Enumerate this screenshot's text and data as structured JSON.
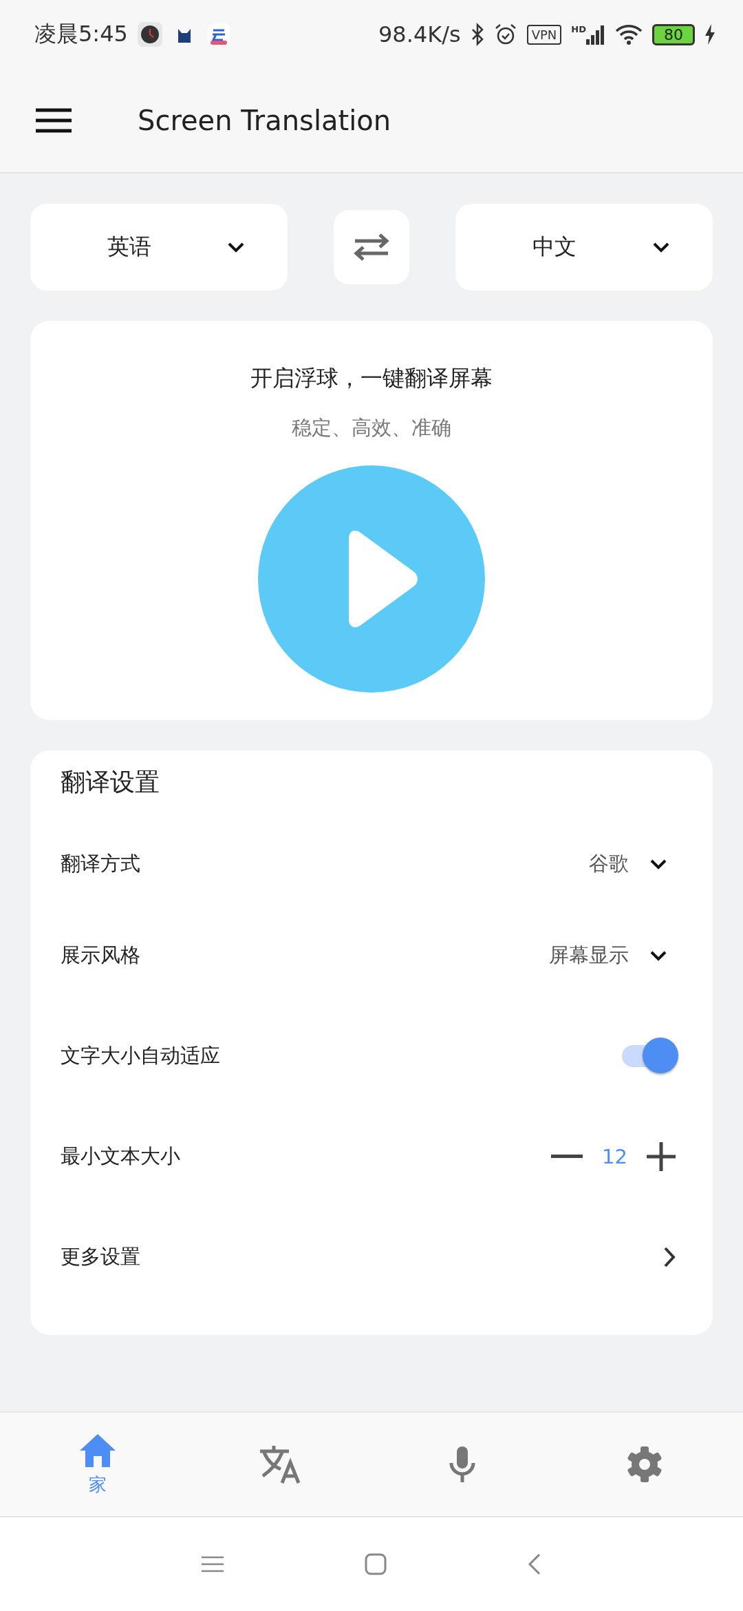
{
  "status_bar": {
    "time": "凌晨5:45",
    "net_speed": "98.4K/s",
    "vpn": "VPN",
    "network": "HD",
    "battery": "80"
  },
  "app_bar": {
    "title": "Screen Translation"
  },
  "languages": {
    "source": "英语",
    "target": "中文"
  },
  "hero": {
    "title": "开启浮球，一键翻译屏幕",
    "subtitle": "稳定、高效、准确"
  },
  "settings": {
    "title": "翻译设置",
    "items": [
      {
        "kind": "dropdown",
        "label": "翻译方式",
        "value": "谷歌"
      },
      {
        "kind": "dropdown",
        "label": "展示风格",
        "value": "屏幕显示"
      },
      {
        "kind": "toggle",
        "label": "文字大小自动适应",
        "on": true
      },
      {
        "kind": "stepper",
        "label": "最小文本大小",
        "value": "12"
      },
      {
        "kind": "link",
        "label": "更多设置"
      }
    ]
  },
  "bottom_nav": [
    {
      "kind": "home",
      "label": "家",
      "selected": true
    },
    {
      "kind": "translate",
      "selected": false
    },
    {
      "kind": "mic",
      "selected": false
    },
    {
      "kind": "settings",
      "selected": false
    }
  ]
}
